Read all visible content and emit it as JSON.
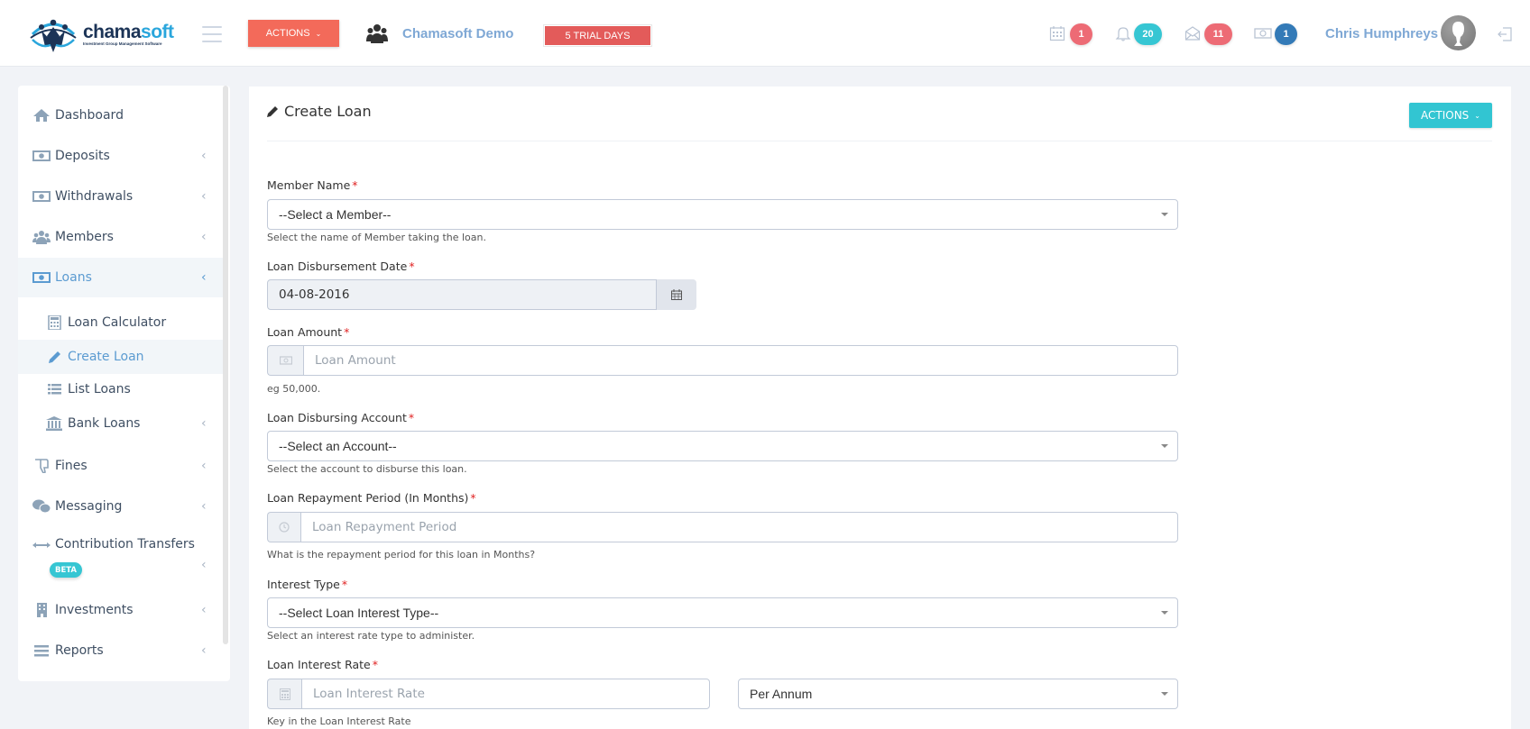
{
  "header": {
    "logo_word_main": "chama",
    "logo_word_accent": "soft",
    "logo_tagline": "Investment Group Management Software",
    "actions_label": "Actions",
    "group_name": "Chamasoft Demo",
    "trial_label": "5 Trial Days",
    "notifications": [
      {
        "icon": "calendar-icon",
        "count": "1",
        "color": "#ed6b75"
      },
      {
        "icon": "bell-icon",
        "count": "20",
        "color": "#36c6d3"
      },
      {
        "icon": "envelope-icon",
        "count": "11",
        "color": "#ed6b75"
      },
      {
        "icon": "money-icon",
        "count": "1",
        "color": "#337ab7"
      }
    ],
    "user_name": "Chris Humphreys"
  },
  "sidebar": {
    "items": [
      {
        "label": "Dashboard",
        "icon": "home-icon",
        "has_children": false
      },
      {
        "label": "Deposits",
        "icon": "money-icon",
        "has_children": true
      },
      {
        "label": "Withdrawals",
        "icon": "money-icon",
        "has_children": true
      },
      {
        "label": "Members",
        "icon": "users-icon",
        "has_children": true
      },
      {
        "label": "Loans",
        "icon": "money-icon",
        "has_children": true,
        "active": true,
        "children": [
          {
            "label": "Loan Calculator",
            "icon": "calculator-icon"
          },
          {
            "label": "Create Loan",
            "icon": "pencil-icon",
            "active": true
          },
          {
            "label": "List Loans",
            "icon": "list-icon"
          },
          {
            "label": "Bank Loans",
            "icon": "bank-icon",
            "has_children": true
          }
        ]
      },
      {
        "label": "Fines",
        "icon": "thumbs-down-icon",
        "has_children": true
      },
      {
        "label": "Messaging",
        "icon": "chat-icon",
        "has_children": true
      },
      {
        "label": "Contribution Transfers",
        "icon": "arrows-h-icon",
        "has_children": true,
        "badge": "BETA"
      },
      {
        "label": "Investments",
        "icon": "building-icon",
        "has_children": true
      },
      {
        "label": "Reports",
        "icon": "bars-icon",
        "has_children": true
      }
    ]
  },
  "main": {
    "title": "Create Loan",
    "actions_label": "ACTIONS",
    "form": {
      "member_name": {
        "label": "Member Name",
        "value": "--Select a Member--",
        "help": "Select the name of Member taking the loan."
      },
      "disbursement_date": {
        "label": "Loan Disbursement Date",
        "value": "04-08-2016"
      },
      "loan_amount": {
        "label": "Loan Amount",
        "placeholder": "Loan Amount",
        "value": "",
        "help": "eg 50,000."
      },
      "disbursing_account": {
        "label": "Loan Disbursing Account",
        "value": "--Select an Account--",
        "help": "Select the account to disburse this loan."
      },
      "repayment_period": {
        "label": "Loan Repayment Period (In Months)",
        "placeholder": "Loan Repayment Period",
        "value": "",
        "help": "What is the repayment period for this loan in Months?"
      },
      "interest_type": {
        "label": "Interest Type",
        "value": "--Select Loan Interest Type--",
        "help": "Select an interest rate type to administer."
      },
      "interest_rate": {
        "label": "Loan Interest Rate",
        "placeholder": "Loan Interest Rate",
        "value": "",
        "period": "Per Annum",
        "help": "Key in the Loan Interest Rate"
      },
      "required_mark": "*"
    }
  }
}
